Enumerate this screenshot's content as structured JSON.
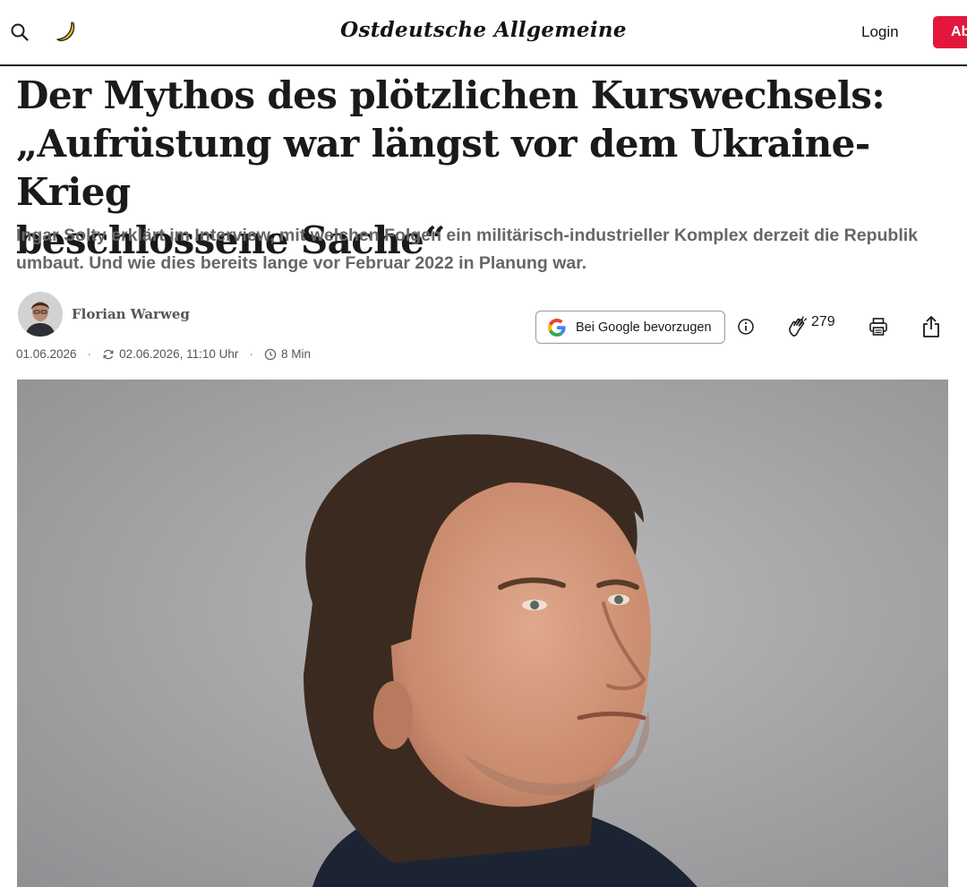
{
  "header": {
    "brand": "Ostdeutsche Allgemeine",
    "login_label": "Login",
    "subscribe_label": "Ab",
    "accent_color": "#e3173d"
  },
  "article": {
    "headline_lines": [
      "Der Mythos des plötzlichen Kurswechsels:",
      "„Aufrüstung war längst vor dem Ukraine-Krieg",
      "beschlossene Sache“"
    ],
    "lead_lines": [
      "Ingar Solty erklärt im Interview, mit welchen Folgen ein militärisch-industrieller Komplex derzeit die Republik",
      "umbaut. Und wie dies bereits lange vor Februar 2022 in Planung war."
    ],
    "author": "Florian Warweg",
    "published": "01.06.2026",
    "updated": "02.06.2026, 11:10 Uhr",
    "read_time": "8 Min",
    "google_button": "Bei Google bevorzugen",
    "clap_count": "279"
  },
  "icons": {
    "search": "search-icon",
    "banana": "banana-icon",
    "google": "google-g-icon",
    "info": "info-icon",
    "clap": "clap-icon",
    "print": "print-icon",
    "share": "share-icon",
    "refresh": "refresh-icon",
    "clock": "clock-icon"
  }
}
